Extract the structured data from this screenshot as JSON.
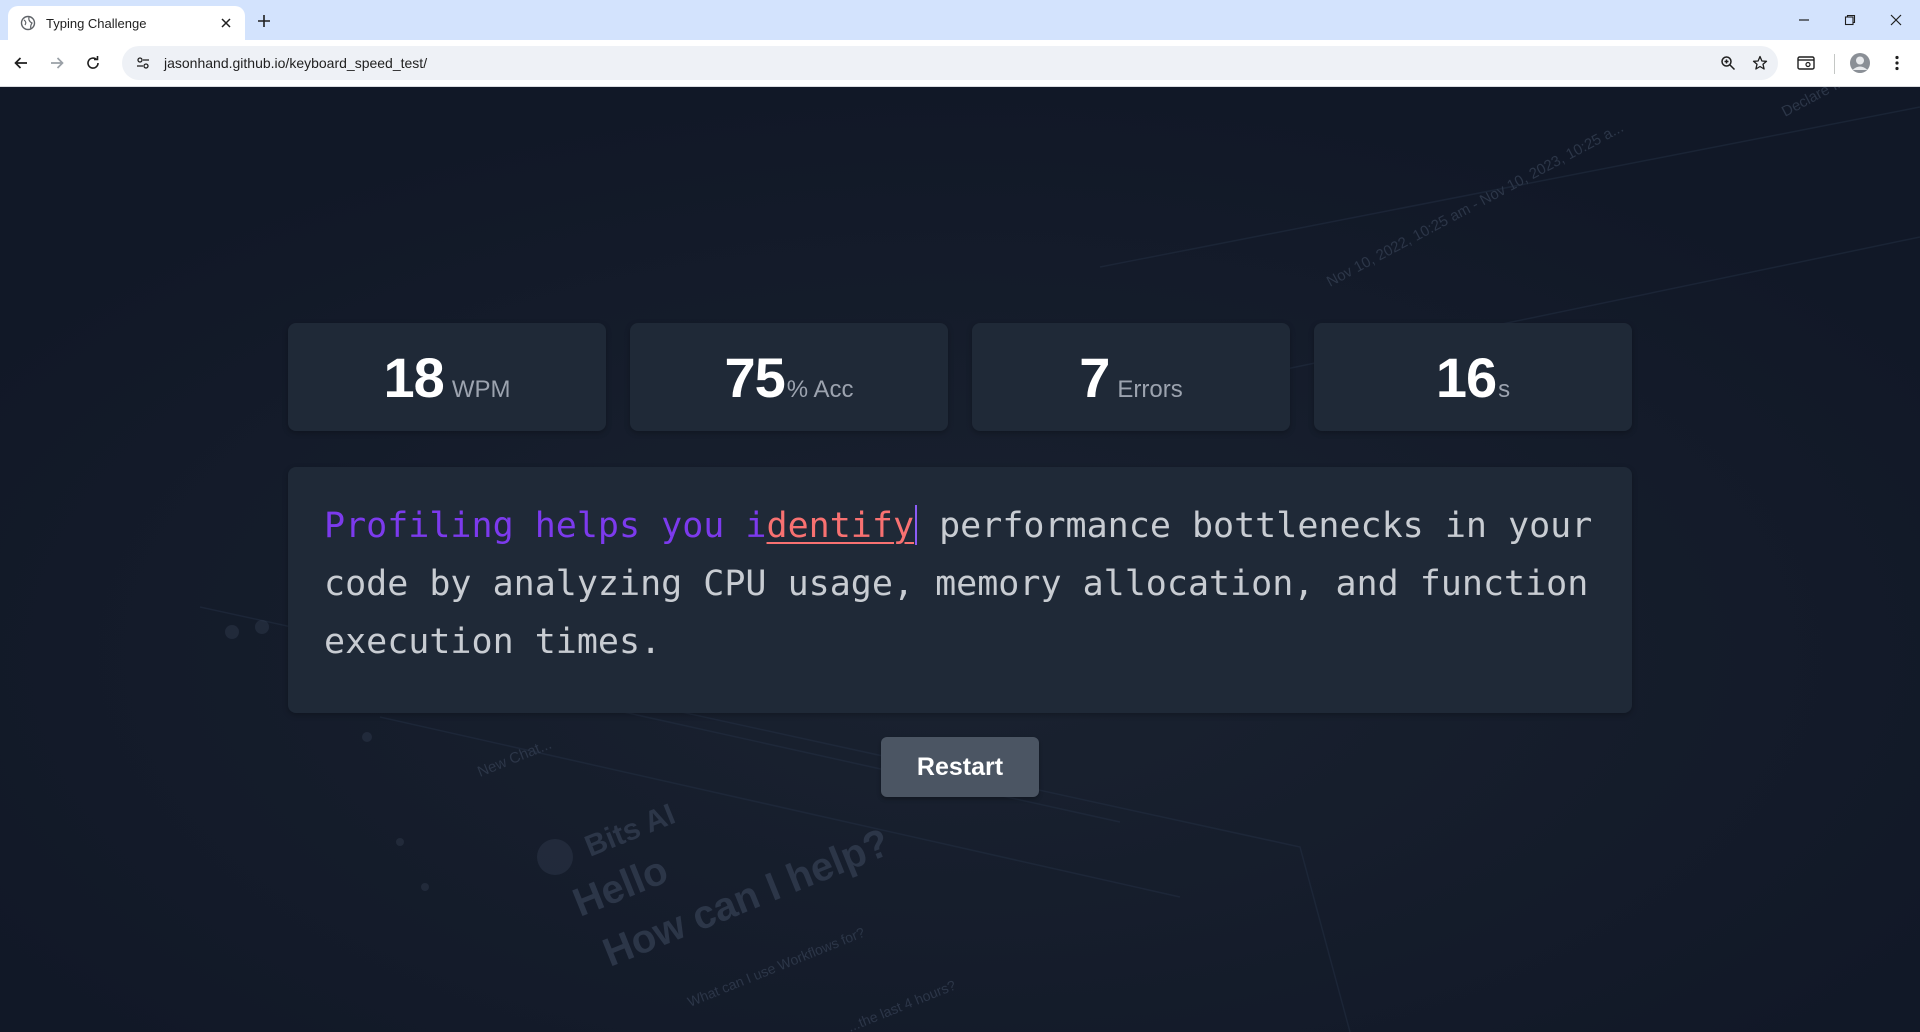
{
  "browser": {
    "tab_title": "Typing Challenge",
    "url": "jasonhand.github.io/keyboard_speed_test/"
  },
  "stats": [
    {
      "value": "18",
      "unit": "WPM"
    },
    {
      "value": "75",
      "unit": "% Acc"
    },
    {
      "value": "7",
      "unit": "Errors"
    },
    {
      "value": "16",
      "unit": "s"
    }
  ],
  "passage": {
    "typed": "Profiling helps you i",
    "error": "dentify",
    "remaining": " performance bottlenecks in your code by analyzing CPU usage, memory allocation, and function execution times."
  },
  "restart_label": "Restart",
  "background_ghost": {
    "assistant_name": "Bits AI",
    "greeting": "Hello",
    "prompt": "How can I help?",
    "new_chat": "New Chat...",
    "suggestion_1": "What can I use Workflows for?",
    "suggestion_2": "...the last 4 hours?",
    "declare_button": "Declare Incident",
    "date_range": "Nov 10, 2022, 10:25 am - Nov 10, 2023, 10:25 a..."
  },
  "colors": {
    "page_bg": "#111827",
    "card_bg": "#1f2937",
    "typed": "#7c3aed",
    "error": "#f87171",
    "untyped": "#c8ccd2",
    "button_bg": "#4b5563"
  }
}
